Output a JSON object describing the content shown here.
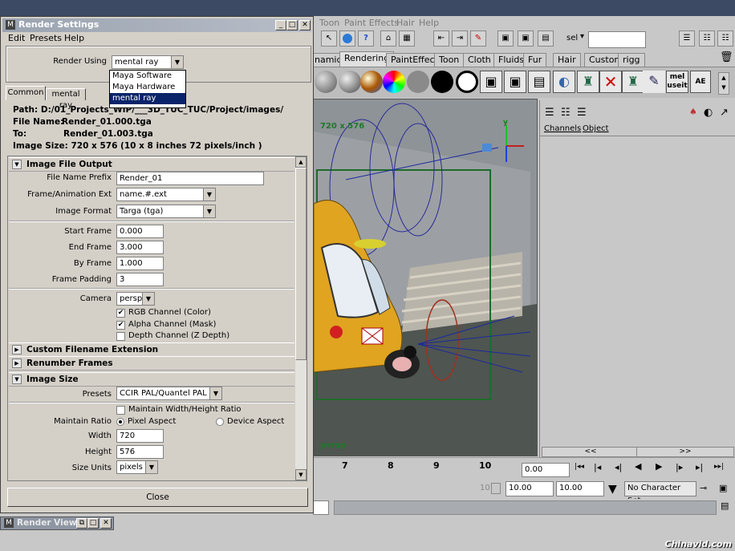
{
  "maya": {
    "menus": [
      "Toon",
      "Paint Effects",
      "Hair",
      "Help"
    ],
    "sel_label": "sel",
    "shelf_tabs": [
      "namics",
      "Rendering",
      "PaintEffects",
      "Toon",
      "Cloth",
      "Fluids",
      "Fur",
      "Hair",
      "Custom",
      "rigg"
    ],
    "shelf_mel": "mel",
    "shelf_useit": "useit",
    "shelf_ae": "AE",
    "viewport": {
      "resolution_label": "720 x 576",
      "camera_label": "persp",
      "axis_y": "y"
    },
    "channel_box": {
      "menus": [
        "Channels",
        "Object"
      ],
      "scroll_left": "<<",
      "scroll_right": ">>"
    },
    "timeline_ticks": [
      "7",
      "8",
      "9",
      "10"
    ],
    "current_time": "0.00",
    "range_end_label": "10",
    "range_start": "10.00",
    "range_end": "10.00",
    "character_set": "No Character Set",
    "render_view_title": "Render View",
    "watermark": "Chinavid.com"
  },
  "render_settings": {
    "title": "Render Settings",
    "menus": [
      "Edit",
      "Presets",
      "Help"
    ],
    "render_using_label": "Render Using",
    "render_using_value": "mental ray",
    "renderer_options": [
      "Maya Software",
      "Maya Hardware",
      "mental ray"
    ],
    "tabs": [
      "Common",
      "mental ray"
    ],
    "path_info": {
      "path": "Path: D:/01_Projects_WIP/___3D_TUC_TUC/Project/images/",
      "file_name_label": "File Name:",
      "file_name": "Render_01.000.tga",
      "to_label": "To:",
      "to": "Render_01.003.tga",
      "image_size": "Image Size: 720 x 576 (10 x 8 inches 72 pixels/inch )"
    },
    "image_file_output": {
      "header": "Image File Output",
      "file_name_prefix_label": "File Name Prefix",
      "file_name_prefix": "Render_01",
      "frame_ext_label": "Frame/Animation Ext",
      "frame_ext": "name.#.ext",
      "image_format_label": "Image Format",
      "image_format": "Targa (tga)",
      "start_frame_label": "Start Frame",
      "start_frame": "0.000",
      "end_frame_label": "End Frame",
      "end_frame": "3.000",
      "by_frame_label": "By Frame",
      "by_frame": "1.000",
      "frame_padding_label": "Frame Padding",
      "frame_padding": "3",
      "camera_label": "Camera",
      "camera": "persp",
      "rgb_channel": "RGB Channel (Color)",
      "rgb_checked": true,
      "alpha_channel": "Alpha Channel (Mask)",
      "alpha_checked": true,
      "depth_channel": "Depth Channel (Z Depth)",
      "depth_checked": false
    },
    "collapsed_sections": [
      "Custom Filename Extension",
      "Renumber Frames"
    ],
    "image_size": {
      "header": "Image Size",
      "presets_label": "Presets",
      "presets": "CCIR PAL/Quantel PAL",
      "maintain_wh": "Maintain Width/Height Ratio",
      "maintain_ratio_label": "Maintain Ratio",
      "pixel_aspect": "Pixel Aspect",
      "device_aspect": "Device Aspect",
      "width_label": "Width",
      "width": "720",
      "height_label": "Height",
      "height": "576",
      "size_units_label": "Size Units",
      "size_units": "pixels"
    },
    "close_button": "Close"
  }
}
